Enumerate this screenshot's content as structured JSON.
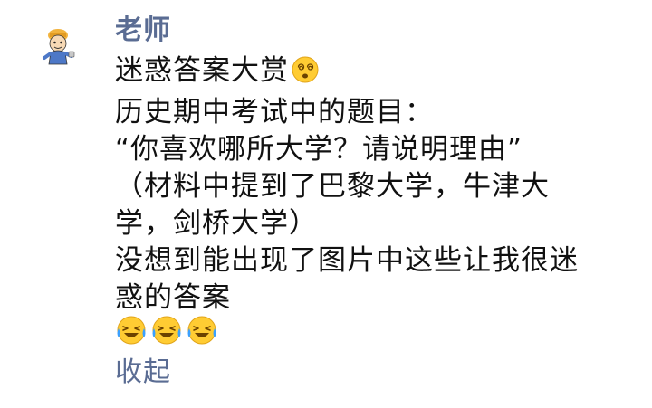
{
  "post": {
    "author": "老师",
    "avatar_icon": "cartoon-character-icon",
    "lines": [
      "迷惑答案大赏",
      "历史期中考试中的题目：",
      "“你喜欢哪所大学？请说明理由”",
      "（材料中提到了巴黎大学，牛津大",
      "学，剑桥大学）",
      "没想到能出现了图片中这些让我很迷",
      "惑的答案"
    ],
    "title_emoji": "dizzy-face-icon",
    "reaction_emojis": [
      "laughing-crying-face-icon",
      "laughing-crying-face-icon",
      "laughing-crying-face-icon"
    ],
    "collapse_label": "收起"
  },
  "colors": {
    "author": "#5a6c93",
    "text": "#111111",
    "emoji_face": "#ffcc33",
    "tears": "#3aa0ff"
  }
}
